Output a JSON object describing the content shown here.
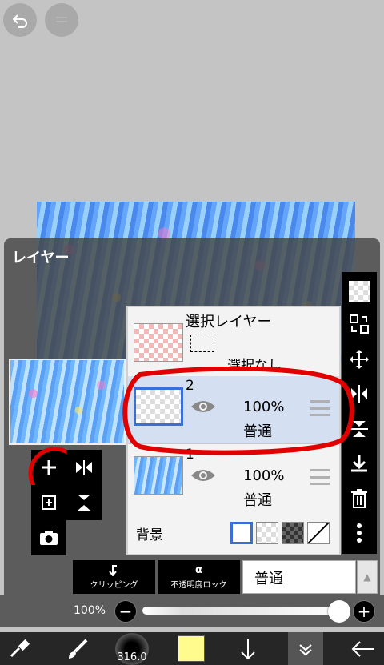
{
  "panel": {
    "title": "レイヤー"
  },
  "layers": {
    "selection": {
      "title": "選択レイヤー",
      "status": "選択なし"
    },
    "items": [
      {
        "number": "2",
        "opacity": "100%",
        "blend": "普通"
      },
      {
        "number": "1",
        "opacity": "100%",
        "blend": "普通"
      }
    ],
    "background": {
      "label": "背景"
    }
  },
  "controls": {
    "clipping_label": "クリッピング",
    "alpha_lock_label": "不透明度ロック",
    "blend_mode": "普通"
  },
  "opacity_slider": {
    "label": "100%",
    "minus": "−",
    "plus": "+",
    "value": 1.0
  },
  "bottom_bar": {
    "brush_size": "316.0"
  },
  "colors": {
    "accent_selected": "#3a6fd8",
    "current_color": "#fffb8c",
    "annotation_red": "#e00000"
  }
}
